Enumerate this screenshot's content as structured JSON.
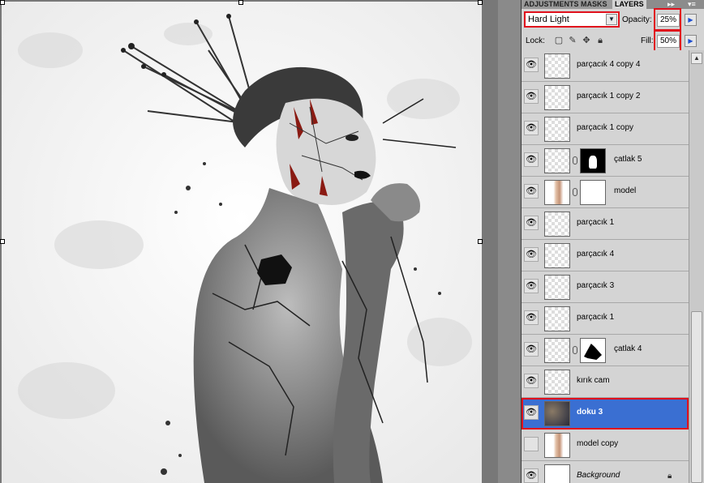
{
  "panel": {
    "tabs": [
      "ADJUSTMENTS",
      "MASKS",
      "LAYERS"
    ],
    "collapse_icon": "▸▸",
    "menu_icon": "▾≡",
    "blend_mode": "Hard Light",
    "opacity_label": "Opacity:",
    "opacity_value": "25%",
    "lock_label": "Lock:",
    "fill_label": "Fill:",
    "fill_value": "50%",
    "accent_color": "#e0101c",
    "selected_color": "#3a6fd2"
  },
  "layers": [
    {
      "name": "parçacık 4 copy 4",
      "visible": true,
      "thumb": "transparent",
      "mask": null
    },
    {
      "name": "parçacık 1 copy 2",
      "visible": true,
      "thumb": "transparent",
      "mask": null
    },
    {
      "name": "parçacık 1 copy",
      "visible": true,
      "thumb": "transparent",
      "mask": null
    },
    {
      "name": "çatlak 5",
      "visible": true,
      "thumb": "transparent",
      "mask": "black"
    },
    {
      "name": "model",
      "visible": true,
      "thumb": "portrait",
      "mask": "white"
    },
    {
      "name": "parçacık 1",
      "visible": true,
      "thumb": "transparent",
      "mask": null
    },
    {
      "name": "parçacık 4",
      "visible": true,
      "thumb": "transparent",
      "mask": null
    },
    {
      "name": "parçacık 3",
      "visible": true,
      "thumb": "transparent",
      "mask": null
    },
    {
      "name": "parçacık 1",
      "visible": true,
      "thumb": "transparent",
      "mask": null
    },
    {
      "name": "çatlak 4",
      "visible": true,
      "thumb": "crack",
      "mask": "crack"
    },
    {
      "name": "kırık cam",
      "visible": true,
      "thumb": "transparent",
      "mask": null
    },
    {
      "name": "doku 3",
      "visible": true,
      "thumb": "texture",
      "mask": null,
      "selected": true
    },
    {
      "name": "model copy",
      "visible": false,
      "thumb": "portrait",
      "mask": null
    },
    {
      "name": "Background",
      "visible": true,
      "thumb": "white",
      "mask": null,
      "locked": true,
      "italic": true
    }
  ]
}
